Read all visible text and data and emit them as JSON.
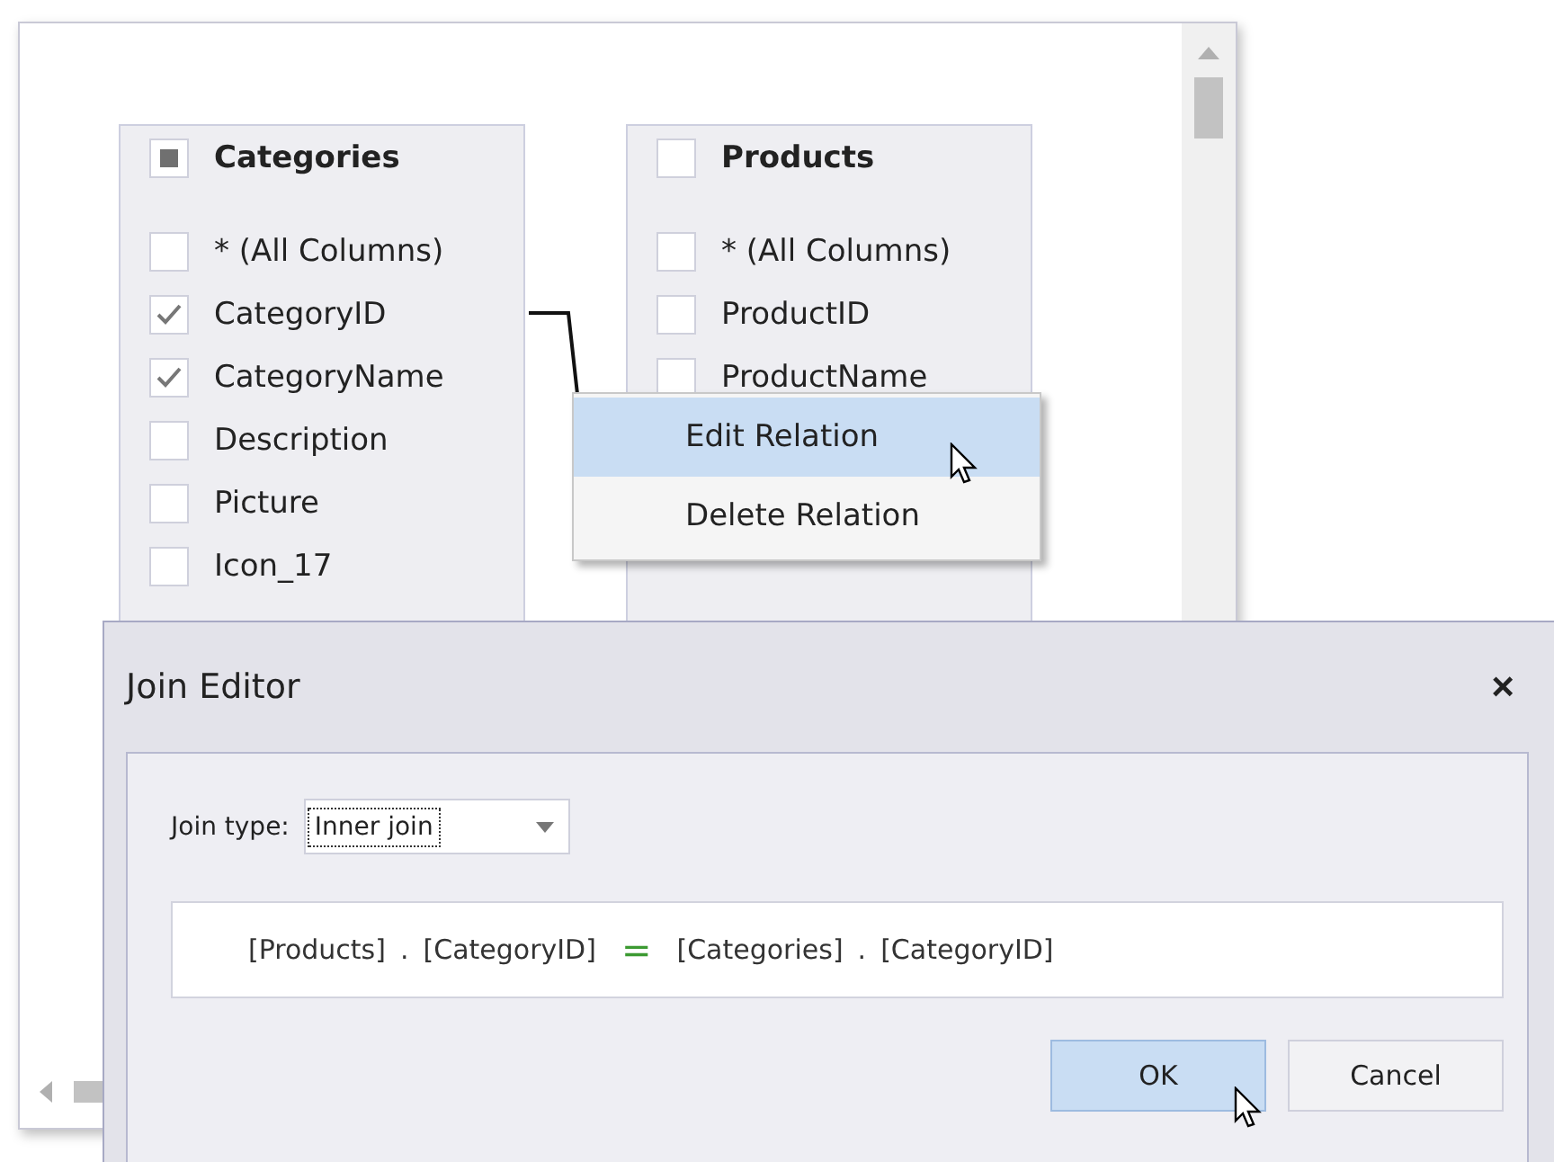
{
  "tables": [
    {
      "title": "Categories",
      "indeterminate": true,
      "columns": [
        {
          "name": "* (All Columns)",
          "checked": false
        },
        {
          "name": "CategoryID",
          "checked": true
        },
        {
          "name": "CategoryName",
          "checked": true
        },
        {
          "name": "Description",
          "checked": false
        },
        {
          "name": "Picture",
          "checked": false
        },
        {
          "name": "Icon_17",
          "checked": false
        }
      ]
    },
    {
      "title": "Products",
      "indeterminate": false,
      "columns": [
        {
          "name": "* (All Columns)",
          "checked": false
        },
        {
          "name": "ProductID",
          "checked": false
        },
        {
          "name": "ProductName",
          "checked": false
        }
      ]
    }
  ],
  "context_menu": {
    "items": [
      {
        "label": "Edit Relation",
        "highlighted": true
      },
      {
        "label": "Delete Relation",
        "highlighted": false
      }
    ]
  },
  "dialog": {
    "title": "Join Editor",
    "close": "×",
    "join_type_label": "Join type:",
    "join_type_value": "Inner join",
    "expression": {
      "left_table": "[Products]",
      "left_column": "[CategoryID]",
      "dot": ".",
      "operator": "=",
      "right_table": "[Categories]",
      "right_column": "[CategoryID]"
    },
    "buttons": [
      {
        "label": "OK",
        "selected": true
      },
      {
        "label": "Cancel",
        "selected": false
      }
    ]
  }
}
